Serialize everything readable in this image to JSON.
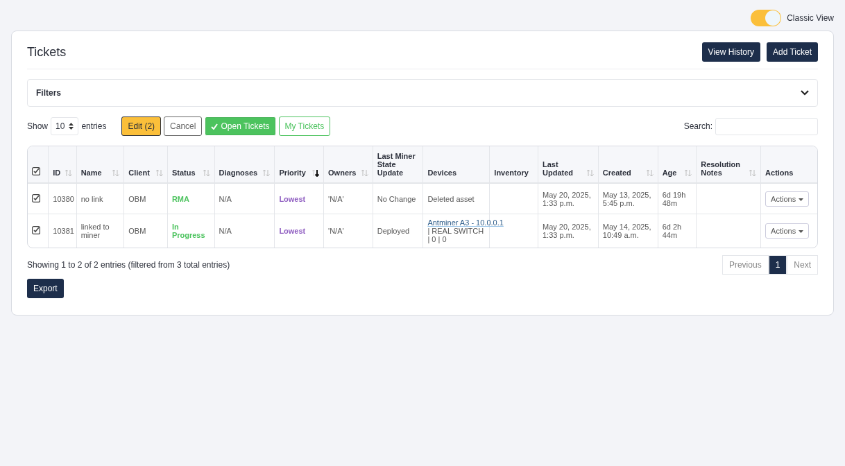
{
  "classic_view": {
    "label": "Classic View",
    "on": true
  },
  "title": "Tickets",
  "header_buttons": [
    "View History",
    "Add Ticket"
  ],
  "filters": {
    "label": "Filters",
    "expanded": false
  },
  "length": {
    "show": "Show",
    "value": "10",
    "entries": "entries"
  },
  "toolbar": [
    {
      "label": "Edit (2)",
      "kind": "warning"
    },
    {
      "label": "Cancel",
      "kind": "plain"
    },
    {
      "label": "Open Tickets",
      "kind": "success",
      "selected": true
    },
    {
      "label": "My Tickets",
      "kind": "outline",
      "selected": false
    }
  ],
  "search": {
    "label": "Search:"
  },
  "table": {
    "all_checked": true,
    "columns": [
      {
        "label": "ID",
        "sortable": true,
        "sorted": false
      },
      {
        "label": "Name",
        "sortable": true,
        "sorted": false
      },
      {
        "label": "Client",
        "sortable": true,
        "sorted": false
      },
      {
        "label": "Status",
        "sortable": true,
        "sorted": false
      },
      {
        "label": "Diagnoses",
        "sortable": true,
        "sorted": false
      },
      {
        "label": "Priority",
        "sortable": true,
        "sorted": true
      },
      {
        "label": "Owners",
        "sortable": true,
        "sorted": false
      },
      {
        "label": "Last Miner State Update",
        "sortable": false
      },
      {
        "label": "Devices",
        "sortable": false
      },
      {
        "label": "Inventory",
        "sortable": false
      },
      {
        "label": "Last Updated",
        "sortable": true,
        "sorted": false
      },
      {
        "label": "Created",
        "sortable": true,
        "sorted": false
      },
      {
        "label": "Age",
        "sortable": true,
        "sorted": false
      },
      {
        "label": "Resolution Notes",
        "sortable": true,
        "sorted": false
      },
      {
        "label": "Actions",
        "sortable": false
      }
    ],
    "rows": [
      {
        "checked": true,
        "id": "10380",
        "name": "no link",
        "client": "OBM",
        "status": "RMA",
        "diagnoses": "N/A",
        "priority": "Lowest",
        "owners": "'N/A'",
        "state": "No Change",
        "device": {
          "text": "Deleted asset"
        },
        "last_updated": "May 20, 2025, 1:33 p.m.",
        "created": "May 13, 2025, 5:45 p.m.",
        "age": "6d 19h 48m",
        "action": "Actions"
      },
      {
        "checked": true,
        "id": "10381",
        "name": "linked to miner",
        "client": "OBM",
        "status": "In Progress",
        "diagnoses": "N/A",
        "priority": "Lowest",
        "owners": "'N/A'",
        "state": "Deployed",
        "device": {
          "link": "Antminer A3 - 10.0.0.1",
          "text": " | REAL SWITCH | 0 | 0"
        },
        "last_updated": "May 20, 2025, 1:33 p.m.",
        "created": "May 14, 2025, 10:49 a.m.",
        "age": "6d 2h 44m",
        "action": "Actions"
      }
    ]
  },
  "info": "Showing 1 to 2 of 2 entries (filtered from 3 total entries)",
  "pagination": [
    {
      "label": "Previous",
      "selected": false
    },
    {
      "label": "1",
      "selected": true
    },
    {
      "label": "Next",
      "selected": false
    }
  ],
  "export": "Export"
}
